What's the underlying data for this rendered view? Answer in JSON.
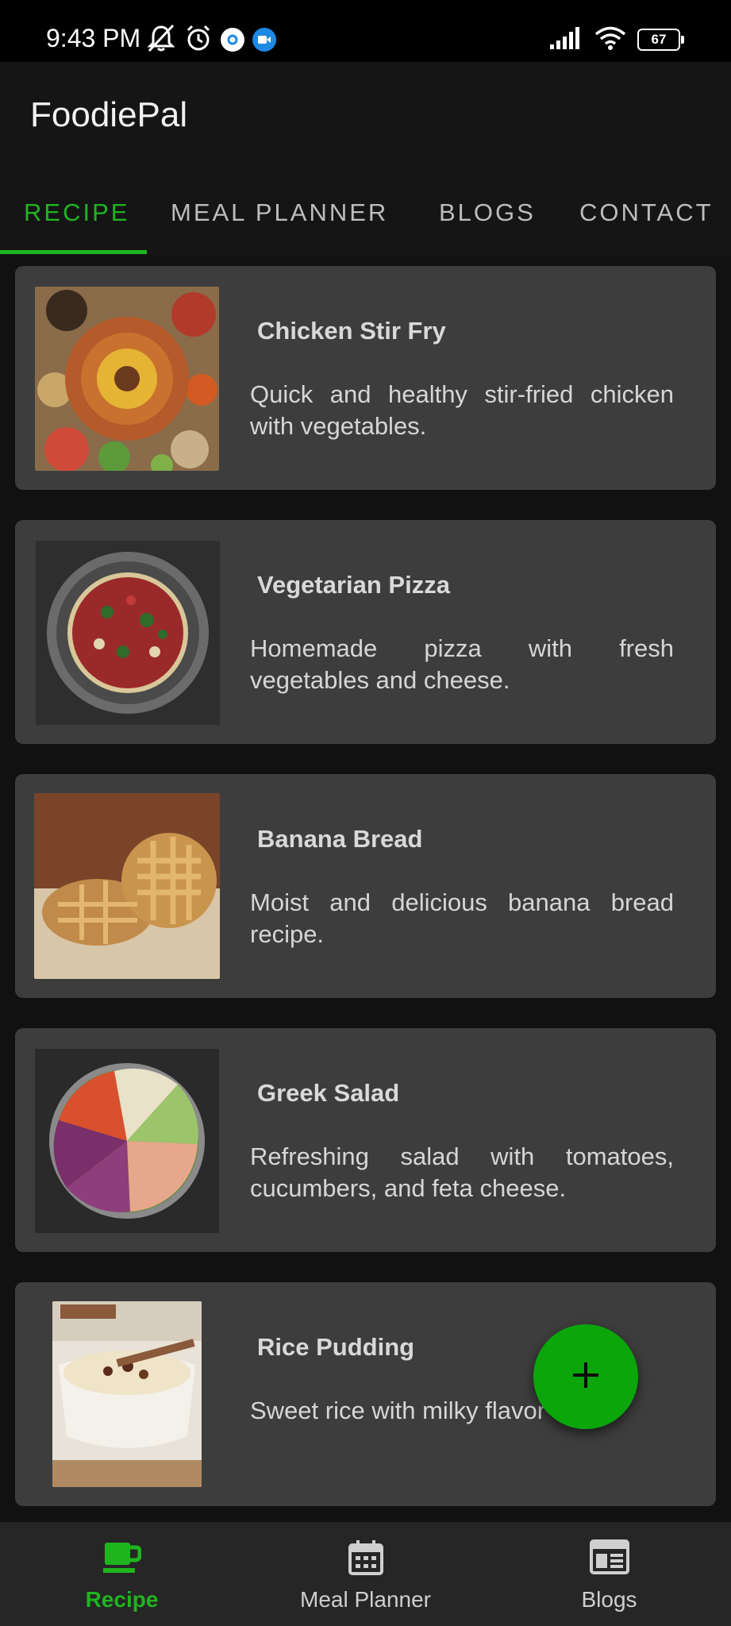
{
  "status_bar": {
    "time": "9:43 PM",
    "battery": "67",
    "icons_left": [
      "muted-bell-icon",
      "alarm-icon",
      "settings-badge-icon",
      "video-badge-icon"
    ],
    "icons_right": [
      "signal-icon",
      "wifi-icon",
      "battery-icon"
    ]
  },
  "app_bar": {
    "title": "FoodiePal"
  },
  "tabs": [
    {
      "label": "RECIPE",
      "active": true
    },
    {
      "label": "MEAL PLANNER",
      "active": false
    },
    {
      "label": "BLOGS",
      "active": false
    },
    {
      "label": "CONTACT",
      "active": false
    }
  ],
  "recipes": [
    {
      "title": "Chicken Stir Fry",
      "description": "Quick and healthy stir-fried chicken with vegetables.",
      "image": "feast-platter-image"
    },
    {
      "title": "Vegetarian Pizza",
      "description": "Homemade pizza with fresh vegetables and cheese.",
      "image": "pizza-image"
    },
    {
      "title": "Banana Bread",
      "description": "Moist and delicious banana bread recipe.",
      "image": "pastry-image"
    },
    {
      "title": "Greek Salad",
      "description": "Refreshing salad with tomatoes, cucumbers, and feta cheese.",
      "image": "salad-bowl-image"
    },
    {
      "title": "Rice Pudding",
      "description": "Sweet rice with milky flavor",
      "image": "rice-pudding-image"
    }
  ],
  "fab": {
    "icon": "plus-icon"
  },
  "bottom_nav": [
    {
      "label": "Recipe",
      "icon": "cup-icon",
      "active": true
    },
    {
      "label": "Meal Planner",
      "icon": "calendar-icon",
      "active": false
    },
    {
      "label": "Blogs",
      "icon": "newspaper-icon",
      "active": false
    }
  ],
  "colors": {
    "accent": "#1fb51f",
    "fab": "#0aa60a",
    "card_bg": "#3d3d3d",
    "background": "#111111",
    "bottom_nav_bg": "#262626"
  }
}
